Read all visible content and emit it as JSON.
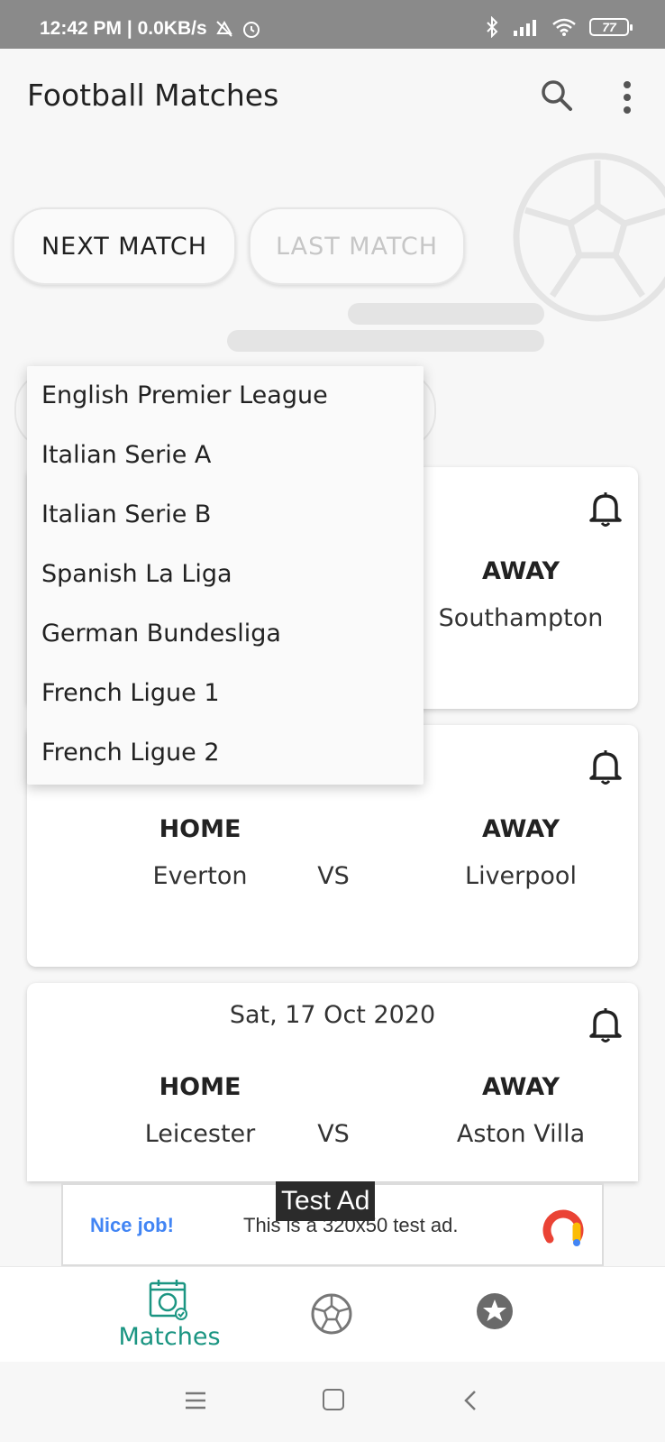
{
  "status_bar": {
    "time_speed": "12:42 PM | 0.0KB/s",
    "battery": "77"
  },
  "app_bar": {
    "title": "Football Matches"
  },
  "tabs": {
    "next": "NEXT MATCH",
    "last": "LAST MATCH"
  },
  "league_menu": {
    "items": [
      "English Premier League",
      "Italian Serie A",
      "Italian Serie B",
      "Spanish La Liga",
      "German Bundesliga",
      "French Ligue 1",
      "French Ligue 2"
    ]
  },
  "matches": [
    {
      "date": "",
      "home_label": "",
      "home_team": "",
      "vs": "",
      "away_label": "AWAY",
      "away_team": "Southampton"
    },
    {
      "date": "",
      "home_label": "HOME",
      "home_team": "Everton",
      "vs": "VS",
      "away_label": "AWAY",
      "away_team": "Liverpool"
    },
    {
      "date": "Sat, 17 Oct 2020",
      "home_label": "HOME",
      "home_team": "Leicester",
      "vs": "VS",
      "away_label": "AWAY",
      "away_team": "Aston Villa"
    }
  ],
  "ad": {
    "label": "Test Ad",
    "nice": "Nice job!",
    "message": "This is a 320x50 test ad."
  },
  "bottom_nav": {
    "matches_label": "Matches",
    "active_color": "#1b9582"
  },
  "colors": {
    "accent": "#1b9582",
    "ad_blue": "#4285f4"
  }
}
